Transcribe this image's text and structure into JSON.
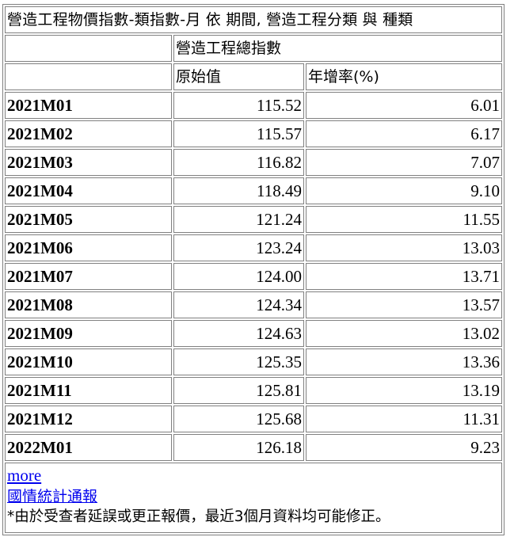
{
  "table": {
    "title": "營造工程物價指數-類指數-月 依 期間, 營造工程分類 與 種類",
    "category_header": "營造工程總指數",
    "col_headers": [
      "原始值",
      "年增率(%)"
    ],
    "rows": [
      {
        "period": "2021M01",
        "value": "115.52",
        "yoy": "6.01"
      },
      {
        "period": "2021M02",
        "value": "115.57",
        "yoy": "6.17"
      },
      {
        "period": "2021M03",
        "value": "116.82",
        "yoy": "7.07"
      },
      {
        "period": "2021M04",
        "value": "118.49",
        "yoy": "9.10"
      },
      {
        "period": "2021M05",
        "value": "121.24",
        "yoy": "11.55"
      },
      {
        "period": "2021M06",
        "value": "123.24",
        "yoy": "13.03"
      },
      {
        "period": "2021M07",
        "value": "124.00",
        "yoy": "13.71"
      },
      {
        "period": "2021M08",
        "value": "124.34",
        "yoy": "13.57"
      },
      {
        "period": "2021M09",
        "value": "124.63",
        "yoy": "13.02"
      },
      {
        "period": "2021M10",
        "value": "125.35",
        "yoy": "13.36"
      },
      {
        "period": "2021M11",
        "value": "125.81",
        "yoy": "13.19"
      },
      {
        "period": "2021M12",
        "value": "125.68",
        "yoy": "11.31"
      },
      {
        "period": "2022M01",
        "value": "126.18",
        "yoy": "9.23"
      }
    ]
  },
  "footer": {
    "more_link": "more",
    "bulletin_link": "國情統計通報",
    "note": "*由於受查者延誤或更正報價，最近3個月資料均可能修正。"
  }
}
